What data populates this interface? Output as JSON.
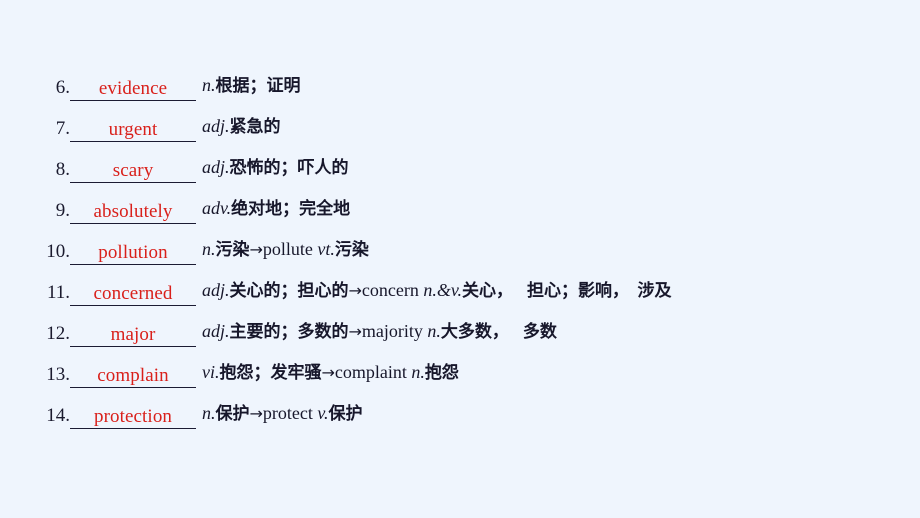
{
  "slide": {
    "background_color": "#eff5fd",
    "answer_color": "#d9201b",
    "text_color": "#17172b",
    "rule_color": "#1b1b33"
  },
  "entries": [
    {
      "number": "6.",
      "answer": "evidence",
      "pos": "n.",
      "meaning": "根据；证明",
      "derivation": "",
      "derivation_pos": "",
      "derivation_meaning": "",
      "tail": ""
    },
    {
      "number": "7.",
      "answer": "urgent",
      "pos": "adj.",
      "meaning": "紧急的",
      "derivation": "",
      "derivation_pos": "",
      "derivation_meaning": "",
      "tail": ""
    },
    {
      "number": "8.",
      "answer": "scary",
      "pos": "adj.",
      "meaning": "恐怖的；吓人的",
      "derivation": "",
      "derivation_pos": "",
      "derivation_meaning": "",
      "tail": ""
    },
    {
      "number": "9.",
      "answer": "absolutely",
      "pos": "adv.",
      "meaning": "绝对地；完全地",
      "derivation": "",
      "derivation_pos": "",
      "derivation_meaning": "",
      "tail": ""
    },
    {
      "number": "10.",
      "answer": "pollution",
      "pos": "n.",
      "meaning": "污染",
      "derivation": "pollute",
      "derivation_pos": "vt.",
      "derivation_meaning": "污染",
      "tail": ""
    },
    {
      "number": "11.",
      "answer": "concerned",
      "pos": "adj.",
      "meaning": "关心的；担心的",
      "derivation": "concern",
      "derivation_pos": "n.&v.",
      "derivation_meaning": "关心，",
      "tail": "担心；影响，　涉及"
    },
    {
      "number": "12.",
      "answer": "major",
      "pos": "adj.",
      "meaning": "主要的；多数的",
      "derivation": "majority",
      "derivation_pos": "n.",
      "derivation_meaning": "大多数，",
      "tail": "多数"
    },
    {
      "number": "13.",
      "answer": "complain",
      "pos": "vi.",
      "meaning": "抱怨；发牢骚",
      "derivation": "complaint",
      "derivation_pos": "n.",
      "derivation_meaning": "抱怨",
      "tail": ""
    },
    {
      "number": "14.",
      "answer": "protection",
      "pos": "n.",
      "meaning": "保护",
      "derivation": "protect",
      "derivation_pos": "v.",
      "derivation_meaning": "保护",
      "tail": ""
    }
  ],
  "icons": {
    "arrow": "→"
  }
}
